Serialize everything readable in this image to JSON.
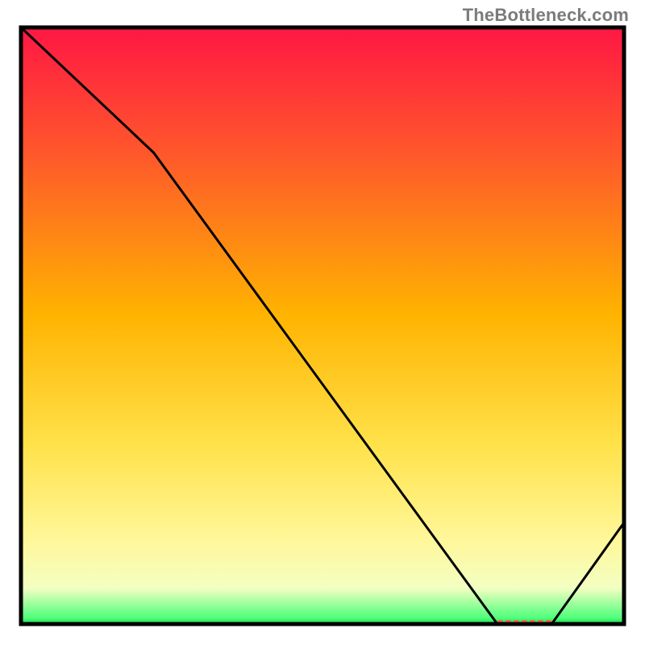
{
  "watermark": "TheBottleneck.com",
  "chart_data": {
    "type": "line",
    "note": "No axis labels, ticks, or numeric values are rendered in the image; x and y values are normalized 0–100 estimates read from the plot itself.",
    "title": "",
    "xlabel": "",
    "ylabel": "",
    "x": [
      0,
      22,
      79,
      88,
      100
    ],
    "y": [
      100,
      79,
      0,
      0,
      17
    ],
    "xlim": [
      0,
      100
    ],
    "ylim": [
      0,
      100
    ],
    "background_gradient_stops": [
      {
        "at": 0.0,
        "color": "#ff1744"
      },
      {
        "at": 0.22,
        "color": "#ff5a2a"
      },
      {
        "at": 0.48,
        "color": "#ffb300"
      },
      {
        "at": 0.7,
        "color": "#ffe24a"
      },
      {
        "at": 0.86,
        "color": "#fff79a"
      },
      {
        "at": 0.94,
        "color": "#f3ffc2"
      },
      {
        "at": 0.99,
        "color": "#4eff7a"
      },
      {
        "at": 1.0,
        "color": "#18d84e"
      }
    ],
    "marker": {
      "label": "",
      "x_range": [
        79,
        88
      ],
      "y": 0,
      "color": "#ff5a4d"
    },
    "frame_color": "#000000",
    "line_color": "#000000",
    "line_width": 3
  }
}
